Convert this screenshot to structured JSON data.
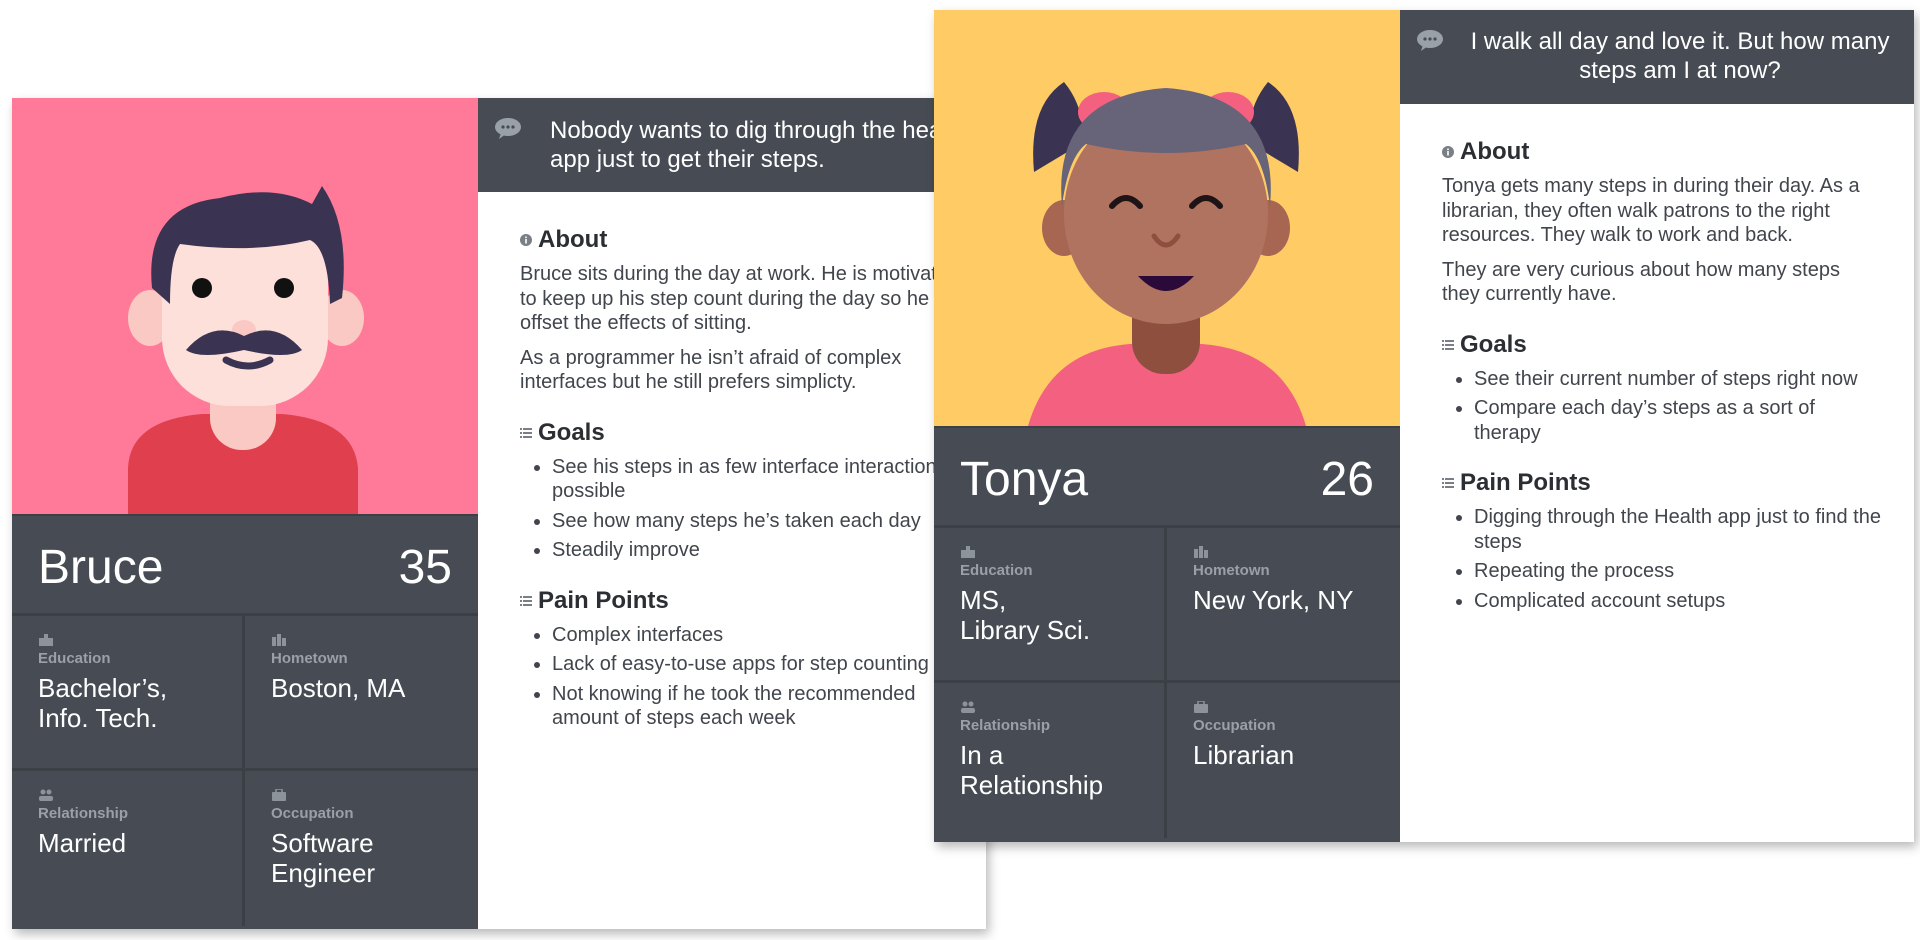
{
  "personas": [
    {
      "id": "bruce",
      "name": "Bruce",
      "age": "35",
      "bg_color": "#ff7a98",
      "quote": "Nobody wants to dig through the health app just to get their steps.",
      "fields": {
        "education_label": "Education",
        "education": "Bachelor’s,\nInfo.  Tech.",
        "hometown_label": "Hometown",
        "hometown": "Boston, MA",
        "relationship_label": "Relationship",
        "relationship": "Married",
        "occupation_label": "Occupation",
        "occupation": "Software\nEngineer"
      },
      "about_title": "About",
      "about": [
        "Bruce sits during the day at work. He is motivated to keep up his step count during the day so he can offset the effects of sitting.",
        "As a programmer he isn’t afraid of complex interfaces but he still prefers simplicty."
      ],
      "goals_title": "Goals",
      "goals": [
        "See his steps in as few interface interactions as possible",
        "See how many steps he’s taken each day",
        "Steadily improve"
      ],
      "pain_title": "Pain Points",
      "pain_points": [
        "Complex interfaces",
        "Lack of easy-to-use apps for step counting",
        "Not knowing if he took the recommended amount of steps each week"
      ]
    },
    {
      "id": "tonya",
      "name": "Tonya",
      "age": "26",
      "bg_color": "#fecb65",
      "quote": "I walk all day and love it. But how many steps am I at now?",
      "fields": {
        "education_label": "Education",
        "education": "MS,\nLibrary Sci.",
        "hometown_label": "Hometown",
        "hometown": "New York, NY",
        "relationship_label": "Relationship",
        "relationship": "In a\nRelationship",
        "occupation_label": "Occupation",
        "occupation": "Librarian"
      },
      "about_title": "About",
      "about": [
        "Tonya gets many steps in during their day. As a librarian, they often walk patrons to the right resources. They walk to work and back.",
        "They are very curious about how many steps they currently have."
      ],
      "goals_title": "Goals",
      "goals": [
        "See their current number of steps right now",
        "Compare each day’s steps as a sort of therapy"
      ],
      "pain_title": "Pain Points",
      "pain_points": [
        "Digging through the Health app just to find the steps",
        "Repeating the process",
        "Complicated account setups"
      ]
    }
  ],
  "colors": {
    "panel_dark": "#474c54",
    "label_gray": "#9aa0a8",
    "bruce_bg": "#ff7a98",
    "tonya_bg": "#fecb65"
  },
  "icons": {
    "quote": "chat-bubble-icon",
    "about": "info-icon",
    "goals": "list-icon",
    "pain": "list-icon",
    "education": "school-icon",
    "hometown": "city-icon",
    "relationship": "people-icon",
    "occupation": "briefcase-icon"
  }
}
